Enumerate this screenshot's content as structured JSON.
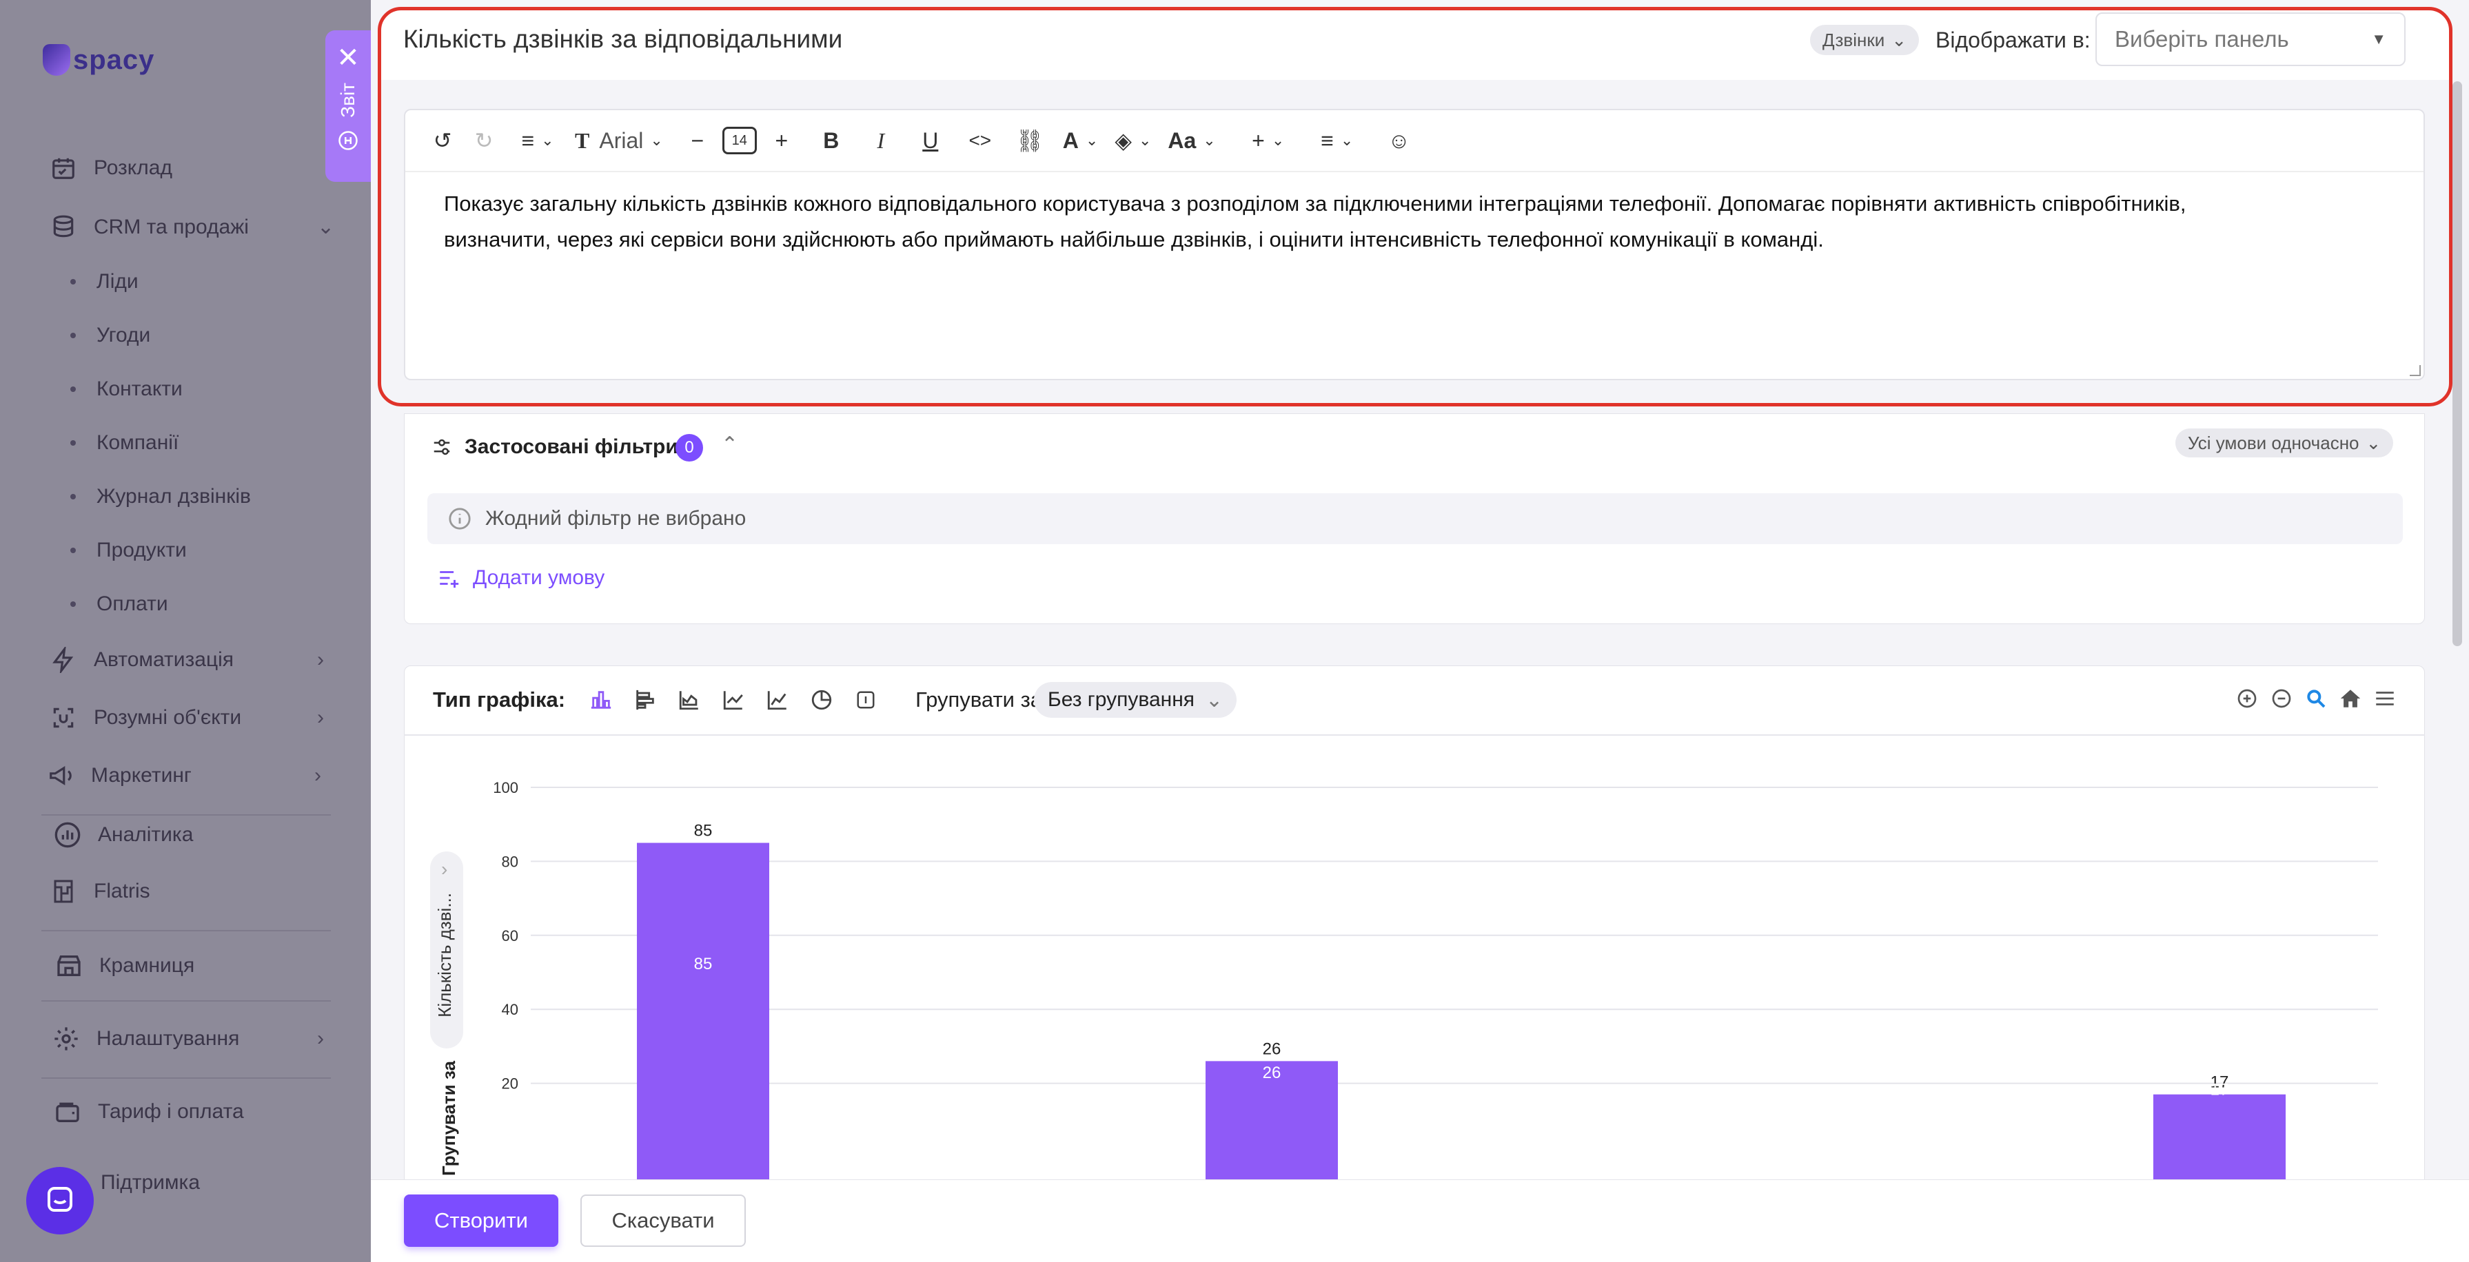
{
  "app": {
    "logo_text": "spacy"
  },
  "sidebar": {
    "items": [
      {
        "label": "Розклад",
        "icon": "calendar-icon"
      },
      {
        "label": "CRM та продажі",
        "icon": "database-icon"
      },
      {
        "label": "Автоматизація",
        "icon": "lightning-icon"
      },
      {
        "label": "Розумні об'єкти",
        "icon": "smart-object-icon"
      },
      {
        "label": "Маркетинг",
        "icon": "megaphone-icon"
      },
      {
        "label": "Аналітика",
        "icon": "analytics-icon"
      },
      {
        "label": "Flatris",
        "icon": "flatris-icon"
      },
      {
        "label": "Крамниця",
        "icon": "store-icon"
      },
      {
        "label": "Налаштування",
        "icon": "gear-icon"
      },
      {
        "label": "Тариф і оплата",
        "icon": "wallet-icon"
      },
      {
        "label": "Підтримка",
        "icon": "support-icon"
      }
    ],
    "crm_sub": [
      "Ліди",
      "Угоди",
      "Контакти",
      "Компанії",
      "Журнал дзвінків",
      "Продукти",
      "Оплати"
    ]
  },
  "report_tab": {
    "label": "Звіт"
  },
  "header": {
    "title": "Кількість дзвінків за відповідальними",
    "source_tag": "Дзвінки",
    "display_label": "Відображати в:",
    "panel_placeholder": "Виберіть панель"
  },
  "editor": {
    "font_name": "Arial",
    "font_size": "14",
    "case_label": "Aa",
    "text_line1": "Показує загальну кількість дзвінків кожного відповідального користувача з розподілом за підключеними інтеграціями телефонії. Допомагає порівняти активність співробітників,",
    "text_line2": "визначити, через які сервіси вони здійснюють або приймають найбільше дзвінків, і оцінити інтенсивність телефонної комунікації в команді."
  },
  "filters": {
    "title": "Застосовані фільтри",
    "count": "0",
    "mode": "Усі умови одночасно",
    "empty": "Жодний фільтр не вибрано",
    "add": "Додати умову"
  },
  "chart_controls": {
    "type_label": "Тип графіка:",
    "group_label": "Групувати за",
    "group_value": "Без групування",
    "y_axis_chip": "Кількість дзві...",
    "group_side": "Групувати за"
  },
  "chart_data": {
    "type": "bar",
    "categories": [
      "",
      "",
      ""
    ],
    "values": [
      85,
      26,
      17
    ],
    "ylim": [
      0,
      100
    ],
    "yticks": [
      20,
      40,
      60,
      80,
      100
    ],
    "color": "#8f5af7",
    "grid": true
  },
  "footer": {
    "create": "Створити",
    "cancel": "Скасувати"
  },
  "colors": {
    "accent": "#7c4dff",
    "highlight": "#e0332a"
  }
}
